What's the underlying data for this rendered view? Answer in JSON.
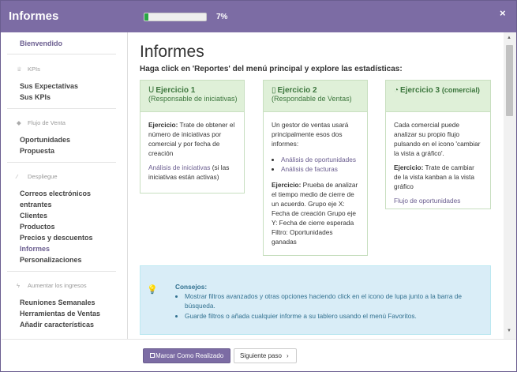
{
  "header": {
    "title": "Informes",
    "progress_text": "7%",
    "progress_fraction": 0.07,
    "close_label": "×"
  },
  "sidebar": {
    "welcome": "Bienvendido",
    "sections": [
      {
        "heading": "KPIs",
        "icon": "trophy-icon",
        "items": [
          "Sus Expectativas",
          "Sus KPIs"
        ]
      },
      {
        "heading": "Flujo de Venta",
        "icon": "tag-icon",
        "items": [
          "Oportunidades",
          "Propuesta"
        ]
      },
      {
        "heading": "Despliegue",
        "icon": "magic-wand-icon",
        "items": [
          "Correos electrónicos",
          "entrantes",
          "Clientes",
          "Productos",
          "Precios y descuentos",
          "Informes",
          "Personalizaciones"
        ]
      },
      {
        "heading": "Aumentar los ingresos",
        "icon": "bolt-icon",
        "items": [
          "Reuniones Semanales",
          "Herramientas de Ventas",
          "Añadir características"
        ]
      }
    ]
  },
  "main": {
    "title": "Informes",
    "subtitle": "Haga click en 'Reportes' del menú principal y explore las estadísticas:",
    "cards": [
      {
        "title": "Ejercicio 1",
        "subtitle": "(Responsable de iniciativas)",
        "icon": "magnet-icon",
        "lead": "Ejercicio:",
        "body": " Trate de obtener el número de iniciativas por comercial y por fecha de creación",
        "link": "Análisis de iniciativas",
        "link_suffix": " (si las iniciativas están activas)"
      },
      {
        "title": "Ejercicio 2",
        "subtitle": "(Respondable de Ventas)",
        "icon": "bar-chart-icon",
        "intro": "Un gestor de ventas usará principalmente esos dos informes:",
        "links": [
          "Análisis de oportunidades",
          "Análisis de facturas"
        ],
        "lead": "Ejercicio:",
        "body": " Prueba de analizar el tiempo medio de cierre de un acuerdo. Grupo eje X: Fecha de creación Grupo eje Y: Fecha de cierre esperada Filtro: Oportunidades ganadas"
      },
      {
        "title": "Ejercicio 3",
        "subtitle": "(comercial)",
        "icon": "pie-chart-icon",
        "intro": "Cada comercial puede analizar su propio flujo pulsando en el icono 'cambiar la vista a gráfico'.",
        "lead": "Ejercicio:",
        "body": " Trate de cambiar de la vista kanban a la vista gráfico",
        "link": "Flujo de oportunidades"
      }
    ],
    "tips": {
      "title": "Consejos:",
      "items": [
        "Mostrar filtros avanzados y otras opciones haciendo click en el icono de lupa junto a la barra de búsqueda.",
        "Guarde filtros o añada cualquier informe a su tablero usando el menú Favoritos."
      ]
    }
  },
  "footer": {
    "done_label": "Marcar Como Realizado",
    "next_label": "Siguiente paso"
  },
  "colors": {
    "header": "#7c6ca4",
    "progress": "#28a745",
    "card_head": "#dff0d8",
    "tips_bg": "#d9edf7"
  }
}
